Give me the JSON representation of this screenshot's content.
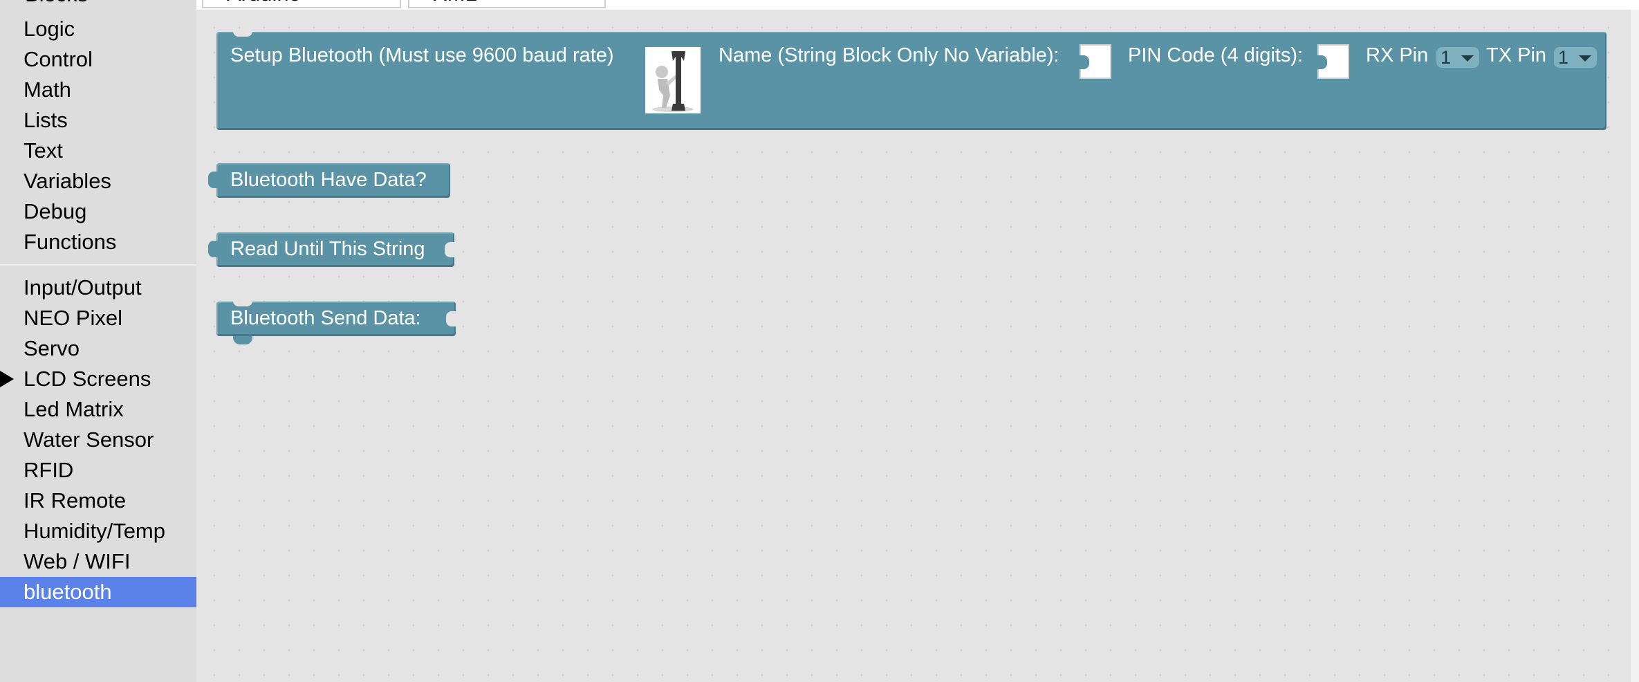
{
  "tabs": [
    {
      "label": "Arduino"
    },
    {
      "label": "XML"
    }
  ],
  "toolbox": {
    "heading": "Blocks",
    "group1": [
      "Logic",
      "Control",
      "Math",
      "Lists",
      "Text",
      "Variables",
      "Debug",
      "Functions"
    ],
    "group2": [
      "Input/Output",
      "NEO Pixel",
      "Servo",
      "LCD Screens",
      "Led Matrix",
      "Water Sensor",
      "RFID",
      "IR Remote",
      "Humidity/Temp",
      "Web / WIFI",
      "bluetooth"
    ],
    "selected": "bluetooth",
    "expandable": "LCD Screens"
  },
  "blocks": {
    "setup": {
      "label": "Setup Bluetooth (Must use 9600 baud rate)",
      "name_label": "Name (String Block Only No Variable):",
      "pin_label": "PIN Code (4 digits):",
      "rx_label": "RX Pin",
      "rx_value": "1",
      "tx_label": "TX Pin",
      "tx_value": "1",
      "image_icon": "wrench-person-icon"
    },
    "have_data": {
      "label": "Bluetooth Have Data?"
    },
    "read_until": {
      "label": "Read Until This String"
    },
    "send_data": {
      "label": "Bluetooth Send Data:"
    }
  },
  "colors": {
    "block": "#5b93a6",
    "selected_category": "#5a82e8",
    "workspace": "#e4e4e4",
    "toolbox": "#dddddd"
  }
}
